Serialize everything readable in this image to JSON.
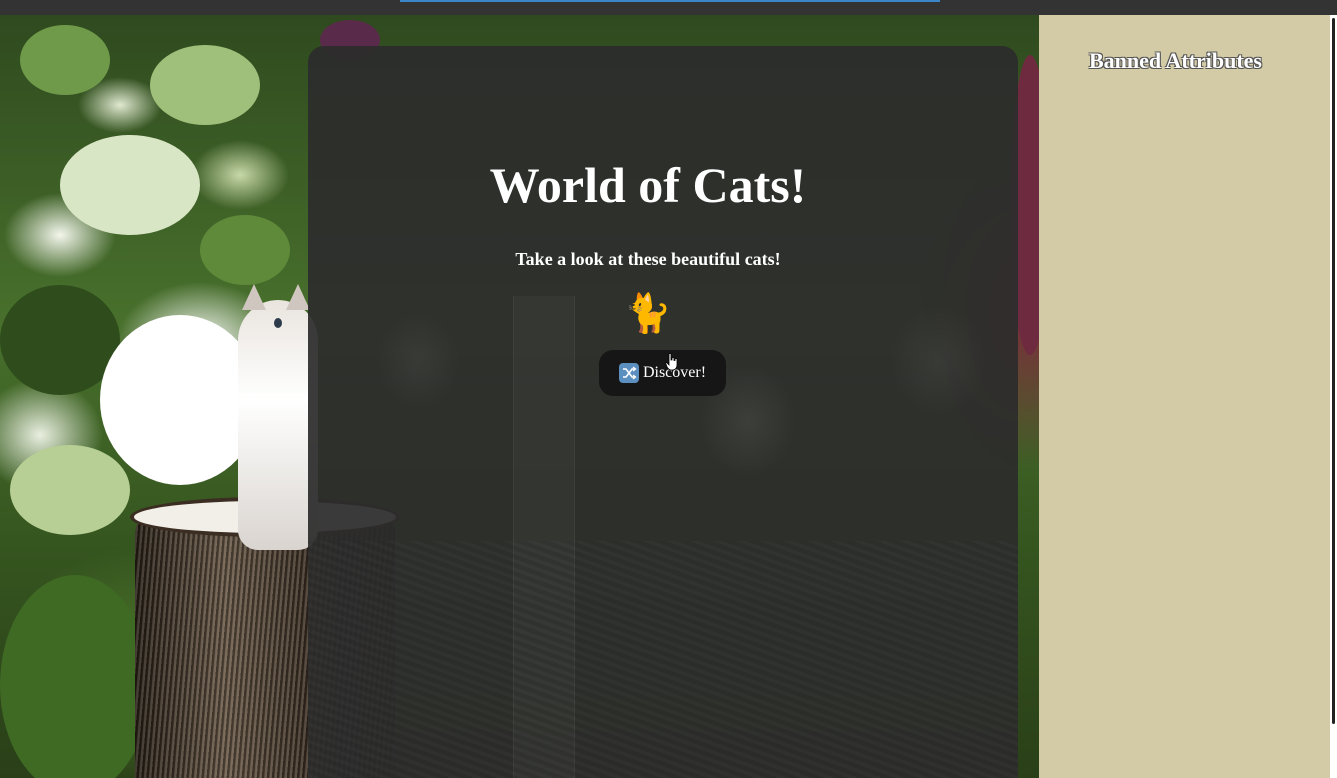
{
  "header": {
    "title": "World of Cats!",
    "subtitle": "Take a look at these beautiful cats!",
    "cat_emoji": "🐈"
  },
  "discover_button": {
    "icon": "shuffle-icon",
    "label": "Discover!"
  },
  "sidebar": {
    "title": "Banned Attributes"
  },
  "colors": {
    "card_background": "#2c2c2c",
    "button_background": "#161616",
    "sidebar_background": "#d3caa6",
    "shuffle_icon": "#5a8fc0",
    "text": "#ffffff"
  }
}
